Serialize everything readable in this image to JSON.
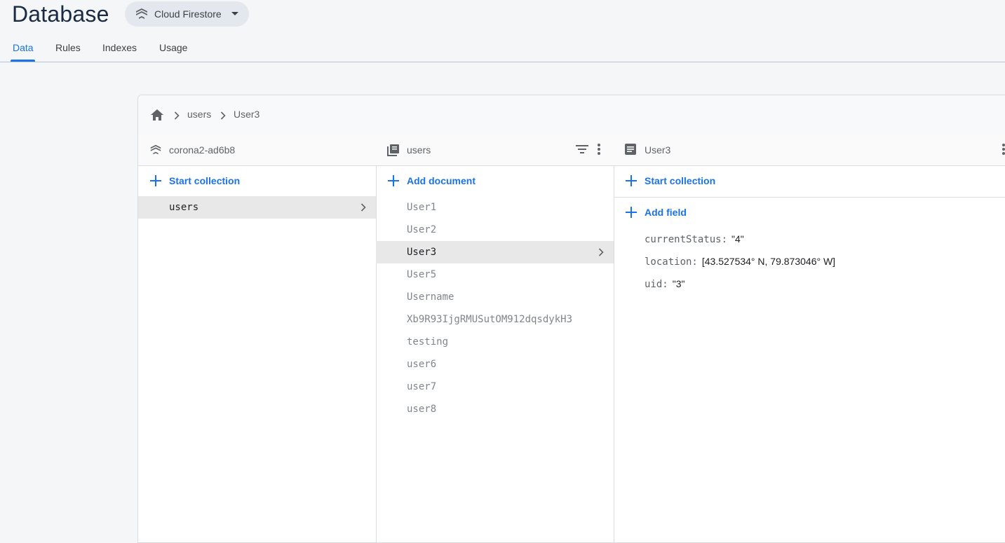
{
  "header": {
    "title": "Database",
    "db_selector": "Cloud Firestore"
  },
  "tabs": [
    {
      "label": "Data",
      "active": true
    },
    {
      "label": "Rules"
    },
    {
      "label": "Indexes"
    },
    {
      "label": "Usage"
    }
  ],
  "breadcrumb": [
    "users",
    "User3"
  ],
  "columns": {
    "root": {
      "title": "corona2-ad6b8",
      "action": "Start collection",
      "items": [
        {
          "label": "users",
          "selected": true
        }
      ]
    },
    "collection": {
      "title": "users",
      "action": "Add document",
      "items": [
        {
          "label": "User1"
        },
        {
          "label": "User2"
        },
        {
          "label": "User3",
          "selected": true
        },
        {
          "label": "User5"
        },
        {
          "label": "Username"
        },
        {
          "label": "Xb9R93IjgRMUSutOM912dqsdykH3"
        },
        {
          "label": "testing"
        },
        {
          "label": "user6"
        },
        {
          "label": "user7"
        },
        {
          "label": "user8"
        }
      ]
    },
    "document": {
      "title": "User3",
      "action_collection": "Start collection",
      "action_field": "Add field",
      "fields": [
        {
          "key": "currentStatus:",
          "value": "\"4\""
        },
        {
          "key": "location:",
          "value": "[43.527534° N, 79.873046° W]"
        },
        {
          "key": "uid:",
          "value": "\"3\""
        }
      ]
    }
  },
  "colors": {
    "accent": "#1a73e8",
    "selected_row": "#e8e8e8",
    "title": "#1a2b45"
  }
}
